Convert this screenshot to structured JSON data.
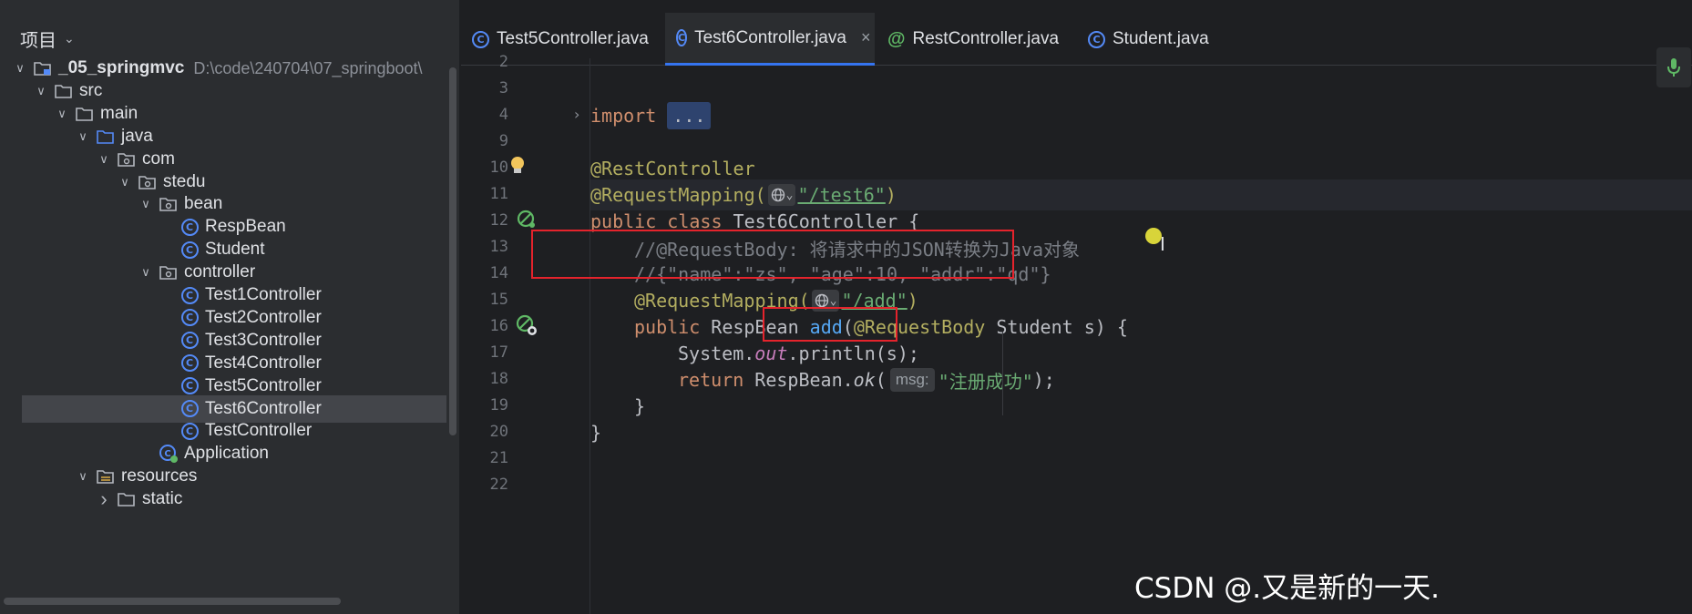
{
  "project_panel": {
    "title": "项目",
    "tree": [
      {
        "label": "_05_springmvc",
        "path": "D:\\code\\240704\\07_springboot\\",
        "icon": "module-folder-icon",
        "depth": 0,
        "expanded": true
      },
      {
        "label": "src",
        "icon": "folder-icon",
        "depth": 1,
        "expanded": true
      },
      {
        "label": "main",
        "icon": "folder-icon",
        "depth": 2,
        "expanded": true
      },
      {
        "label": "java",
        "icon": "source-folder-icon",
        "depth": 3,
        "expanded": true
      },
      {
        "label": "com",
        "icon": "package-icon",
        "depth": 4,
        "expanded": true
      },
      {
        "label": "stedu",
        "icon": "package-icon",
        "depth": 5,
        "expanded": true
      },
      {
        "label": "bean",
        "icon": "package-icon",
        "depth": 6,
        "expanded": true
      },
      {
        "label": "RespBean",
        "icon": "class-icon",
        "depth": 7
      },
      {
        "label": "Student",
        "icon": "class-icon",
        "depth": 7
      },
      {
        "label": "controller",
        "icon": "package-icon",
        "depth": 6,
        "expanded": true
      },
      {
        "label": "Test1Controller",
        "icon": "class-icon",
        "depth": 7
      },
      {
        "label": "Test2Controller",
        "icon": "class-icon",
        "depth": 7
      },
      {
        "label": "Test3Controller",
        "icon": "class-icon",
        "depth": 7
      },
      {
        "label": "Test4Controller",
        "icon": "class-icon",
        "depth": 7
      },
      {
        "label": "Test5Controller",
        "icon": "class-icon",
        "depth": 7
      },
      {
        "label": "Test6Controller",
        "icon": "class-icon",
        "depth": 7,
        "selected": true
      },
      {
        "label": "TestController",
        "icon": "class-icon",
        "depth": 7
      },
      {
        "label": "Application",
        "icon": "spring-app-icon",
        "depth": 6
      },
      {
        "label": "resources",
        "icon": "resources-folder-icon",
        "depth": 3,
        "expanded": true
      },
      {
        "label": "static",
        "icon": "folder-icon",
        "depth": 4,
        "expanded": false
      }
    ]
  },
  "tabs": [
    {
      "label": "Test5Controller.java",
      "icon": "class-icon",
      "active": false
    },
    {
      "label": "Test6Controller.java",
      "icon": "class-icon",
      "active": true,
      "close": "×"
    },
    {
      "label": "RestController.java",
      "icon": "annotation-icon",
      "active": false
    },
    {
      "label": "Student.java",
      "icon": "class-icon",
      "active": false
    }
  ],
  "line_numbers": [
    "2",
    "3",
    "4",
    "9",
    "10",
    "11",
    "12",
    "13",
    "14",
    "15",
    "16",
    "17",
    "18",
    "19",
    "20",
    "21",
    "22"
  ],
  "code": {
    "l4_kw": "import",
    "l4_fold": "...",
    "l10": "@RestController",
    "l11_ann": "@RequestMapping(",
    "l11_str": "\"/test6\"",
    "l11_end": ")",
    "l12_kw": "public class",
    "l12_rest": " Test6Controller {",
    "l13": "//@RequestBody: 将请求中的JSON转换为Java对象",
    "l14": "//{\"name\":\"zs\", \"age\":10, \"addr\":\"qd\"}",
    "l15_ann": "@RequestMapping(",
    "l15_str": "\"/add\"",
    "l15_end": ")",
    "l16_kw": "public",
    "l16_type": " RespBean ",
    "l16_fn": "add",
    "l16_paren": "(",
    "l16_ann": "@RequestBody",
    "l16_rest": " Student s) {",
    "l17_a": "System.",
    "l17_b": "out",
    "l17_c": ".println(s);",
    "l18_kw": "return",
    "l18_a": " RespBean.",
    "l18_b": "ok",
    "l18_c": "(",
    "l18_hint": "msg:",
    "l18_str": "\"注册成功\"",
    "l18_end": ");",
    "l19": "}",
    "l20": "}"
  },
  "watermark": "CSDN @.又是新的一天."
}
